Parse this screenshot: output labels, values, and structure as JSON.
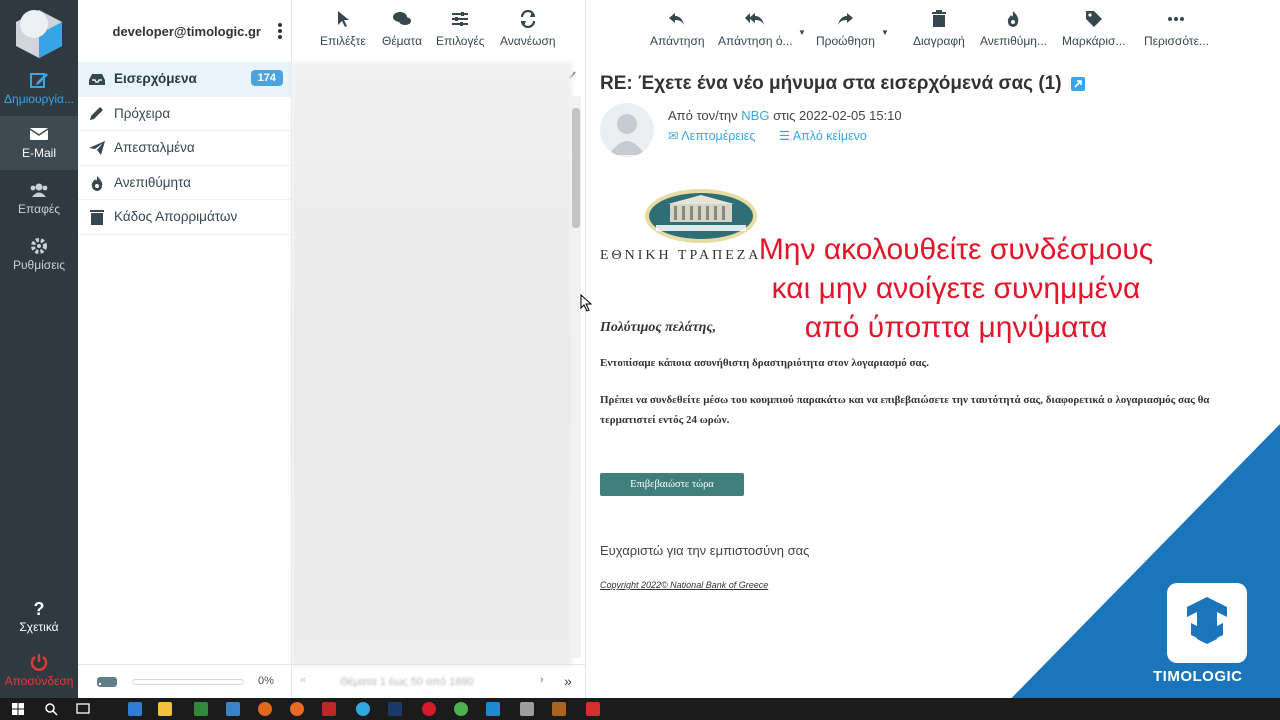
{
  "rail": {
    "items": [
      {
        "label": "Δημιουργία..."
      },
      {
        "label": "E-Mail"
      },
      {
        "label": "Επαφές"
      },
      {
        "label": "Ρυθμίσεις"
      },
      {
        "label": "Σχετικά"
      },
      {
        "label": "Αποσύνδεση"
      }
    ]
  },
  "account": {
    "email": "developer@timologic.gr"
  },
  "folders": [
    {
      "label": "Εισερχόμενα",
      "count": "174"
    },
    {
      "label": "Πρόχειρα"
    },
    {
      "label": "Απεσταλμένα"
    },
    {
      "label": "Ανεπιθύμητα"
    },
    {
      "label": "Κάδος Απορριμάτων"
    }
  ],
  "quota": {
    "percent": "0%",
    "fraction": 0
  },
  "list_toolbar": {
    "select": "Επιλέξτε",
    "threads": "Θέματα",
    "options": "Επιλογές",
    "refresh": "Ανανέωση"
  },
  "pager": {
    "text": "Θέματα 1 έως 50 από 1690"
  },
  "reader_toolbar": {
    "reply": "Απάντηση",
    "reply_all": "Απάντηση ό...",
    "forward": "Προώθηση",
    "delete": "Διαγραφή",
    "junk": "Ανεπιθύμη...",
    "mark": "Μαρκάρισ...",
    "more": "Περισσότε..."
  },
  "message": {
    "subject": "RE: Έχετε ένα νέο μήνυμα στα εισερχόμενά σας (1)",
    "from_prefix": "Από τον/την",
    "from_name": "NBG",
    "from_suffix": "στις 2022-02-05 15:10",
    "details_link": "Λεπτομέρειες",
    "plain_link": "Απλό κείμενο",
    "bank_name": "ΕΘΝΙΚΗ ΤΡΑΠΕΖΑ",
    "warning": [
      "Μην ακολουθείτε συνδέσμους",
      "και μην ανοίγετε συνημμένα",
      "από ύποπτα μηνύματα"
    ],
    "salutation": "Πολύτιμος πελάτης,",
    "para1": "Εντοπίσαμε κάποια ασυνήθιστη δραστηριότητα στον λογαριασμό σας.",
    "para2": "Πρέπει να συνδεθείτε μέσω του κουμπιού παρακάτω και να επιβεβαιώσετε την ταυτότητά σας, διαφορετικά ο λογαριασμός σας θα τερματιστεί εντός 24 ωρών.",
    "button": "Επιβεβαιώστε τώρα",
    "thanks": "Ευχαριστώ για την εμπιστοσύνη σας",
    "copyright": "Copyright 2022© National Bank of Greece"
  },
  "brand": {
    "name": "TIMOLOGIC",
    "color": "#1b75bb"
  },
  "colors": {
    "accent": "#3aa5e6",
    "rail": "#2f3a40",
    "warning": "#e3152b",
    "button": "#417f7d"
  }
}
